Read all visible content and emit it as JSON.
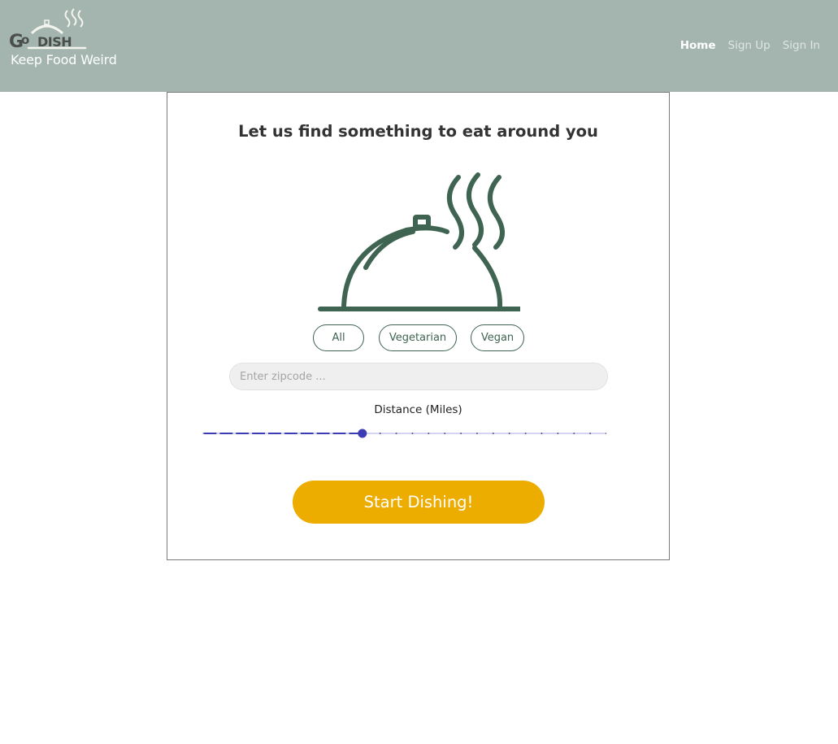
{
  "header": {
    "logo_text": "GoDISH",
    "tagline": "Keep Food Weird",
    "nav": [
      {
        "label": "Home",
        "active": true
      },
      {
        "label": "Sign Up",
        "active": false
      },
      {
        "label": "Sign In",
        "active": false
      }
    ]
  },
  "main": {
    "heading": "Let us find something to eat around you",
    "illustration_icon": "cloche-icon",
    "filters": [
      "All",
      "Vegetarian",
      "Vegan"
    ],
    "zip_placeholder": "Enter zipcode ...",
    "distance_label": "Distance (Miles)",
    "distance": {
      "steps": 25,
      "selected_step": 10
    },
    "start_button": "Start Dishing!"
  },
  "colors": {
    "header_bg": "#a3b5ae",
    "icon_green": "#3f6451",
    "slider_blue": "#3c3cb4",
    "cta_yellow": "#edac00"
  }
}
